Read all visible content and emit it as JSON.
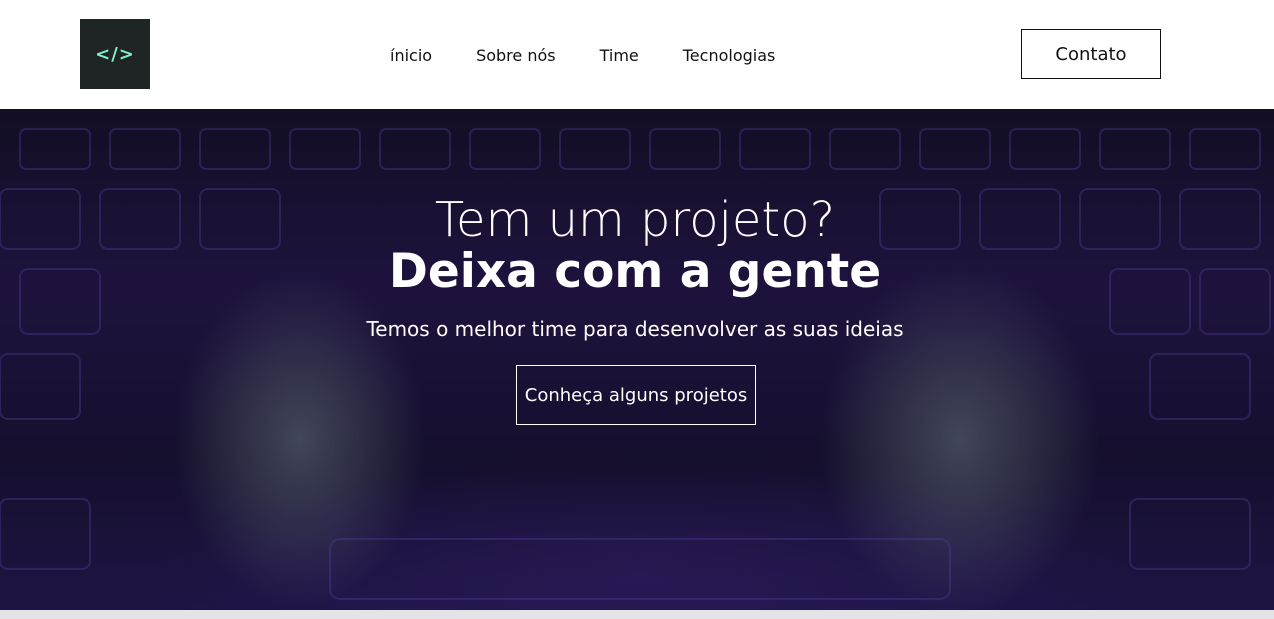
{
  "header": {
    "logo_icon": "code-brackets-icon",
    "logo_glyph": "</>",
    "nav": [
      {
        "label": "ínicio"
      },
      {
        "label": "Sobre nós"
      },
      {
        "label": "Time"
      },
      {
        "label": "Tecnologias"
      }
    ],
    "contact_label": "Contato"
  },
  "hero": {
    "line1": "Tem um projeto?",
    "line2": "Deixa com a gente",
    "subtitle": "Temos o melhor time para desenvolver as suas ideias",
    "cta_label": "Conheça alguns projetos",
    "background_image": "hands-typing-on-keyboard"
  },
  "colors": {
    "logo_bg": "#1f2424",
    "logo_accent": "#7ef2c6",
    "hero_tint": "#2a1a55",
    "text_dark": "#111111",
    "text_light": "#ffffff"
  }
}
